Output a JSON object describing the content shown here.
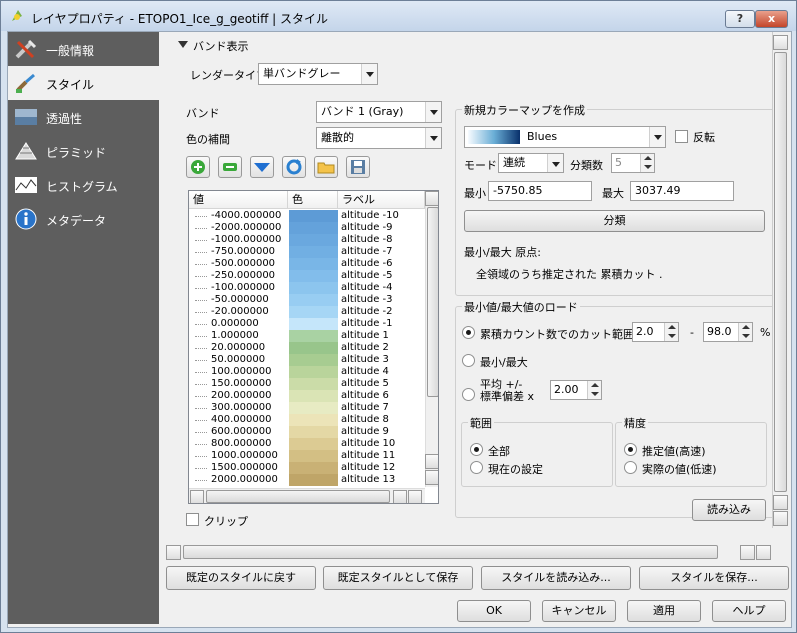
{
  "window": {
    "title": "レイヤプロパティ - ETOPO1_Ice_g_geotiff | スタイル",
    "help": "?",
    "close": "x"
  },
  "sidebar": {
    "items": [
      {
        "label": "一般情報",
        "icon": "tools-icon"
      },
      {
        "label": "スタイル",
        "icon": "brush-icon"
      },
      {
        "label": "透過性",
        "icon": "transparency-icon"
      },
      {
        "label": "ピラミッド",
        "icon": "pyramid-icon"
      },
      {
        "label": "ヒストグラム",
        "icon": "histogram-icon"
      },
      {
        "label": "メタデータ",
        "icon": "info-icon"
      }
    ],
    "selected": 1
  },
  "band": {
    "section": "バンド表示",
    "renderer_label": "レンダータイプ",
    "renderer_value": "単バンドグレー",
    "band_label": "バンド",
    "band_value": "バンド 1 (Gray)",
    "interp_label": "色の補間",
    "interp_value": "離散的"
  },
  "toolbar_icons": [
    "add-entry-icon",
    "remove-entry-icon",
    "sort-icon",
    "refresh-icon",
    "load-folder-icon",
    "save-icon"
  ],
  "table": {
    "headers": [
      "値",
      "色",
      "ラベル"
    ],
    "rows": [
      {
        "value": "-4000.000000",
        "color": "#5d9bd6",
        "label": "altitude -10"
      },
      {
        "value": "-2000.000000",
        "color": "#64a2db",
        "label": "altitude -9"
      },
      {
        "value": "-1000.000000",
        "color": "#6aa8df",
        "label": "altitude -8"
      },
      {
        "value": "-750.000000",
        "color": "#71afe3",
        "label": "altitude -7"
      },
      {
        "value": "-500.000000",
        "color": "#79b6e7",
        "label": "altitude -6"
      },
      {
        "value": "-250.000000",
        "color": "#82bdeb",
        "label": "altitude -5"
      },
      {
        "value": "-100.000000",
        "color": "#8cc5ee",
        "label": "altitude -4"
      },
      {
        "value": "-50.000000",
        "color": "#98cdf2",
        "label": "altitude -3"
      },
      {
        "value": "-20.000000",
        "color": "#a6d6f5",
        "label": "altitude -2"
      },
      {
        "value": "0.000000",
        "color": "#c5e6fa",
        "label": "altitude -1"
      },
      {
        "value": "1.000000",
        "color": "#a9d2a3",
        "label": "altitude 1"
      },
      {
        "value": "20.000000",
        "color": "#98c58b",
        "label": "altitude 2"
      },
      {
        "value": "50.000000",
        "color": "#a7cc91",
        "label": "altitude 3"
      },
      {
        "value": "100.000000",
        "color": "#b9d49b",
        "label": "altitude 4"
      },
      {
        "value": "150.000000",
        "color": "#cbdca8",
        "label": "altitude 5"
      },
      {
        "value": "200.000000",
        "color": "#dae4b5",
        "label": "altitude 6"
      },
      {
        "value": "300.000000",
        "color": "#e7ebc3",
        "label": "altitude 7"
      },
      {
        "value": "400.000000",
        "color": "#ece4b8",
        "label": "altitude 8"
      },
      {
        "value": "600.000000",
        "color": "#e4d8a5",
        "label": "altitude 9"
      },
      {
        "value": "800.000000",
        "color": "#dccb93",
        "label": "altitude 10"
      },
      {
        "value": "1000.000000",
        "color": "#d3bf84",
        "label": "altitude 11"
      },
      {
        "value": "1500.000000",
        "color": "#c9b175",
        "label": "altitude 12"
      },
      {
        "value": "2000.000000",
        "color": "#bfa568",
        "label": "altitude 13"
      }
    ]
  },
  "clip_label": "クリップ",
  "colormap": {
    "title": "新規カラーマップを作成",
    "ramp_name": "Blues",
    "invert_label": "反転",
    "mode_label": "モード",
    "mode_value": "連続",
    "classes_label": "分類数",
    "classes_value": "5",
    "min_label": "最小",
    "min_value": "-5750.85",
    "max_label": "最大",
    "max_value": "3037.49",
    "classify": "分類",
    "origin_label": "最小/最大 原点:",
    "origin_text": "全領域のうち推定された 累積カット ."
  },
  "minmax": {
    "title": "最小値/最大値のロード",
    "cumulative_label": "累積カウント数でのカット範囲",
    "cum_low": "2.0",
    "dash": "-",
    "cum_high": "98.0",
    "pct": "%",
    "minmax_label": "最小/最大",
    "mean_label_1": "平均 +/-",
    "mean_label_2": "標準偏差 x",
    "std_value": "2.00",
    "extent_title": "範囲",
    "extent_full": "全部",
    "extent_current": "現在の設定",
    "accuracy_title": "精度",
    "acc_estimate": "推定値(高速)",
    "acc_actual": "実際の値(低速)",
    "load": "読み込み"
  },
  "bottom": {
    "restore": "既定のスタイルに戻す",
    "save_default": "既定スタイルとして保存",
    "load_style": "スタイルを読み込み...",
    "save_style": "スタイルを保存...",
    "ok": "OK",
    "cancel": "キャンセル",
    "apply": "適用",
    "help": "ヘルプ"
  },
  "colors": {
    "accent": "#0a62c6",
    "sidebar": "#5e5e5e"
  }
}
